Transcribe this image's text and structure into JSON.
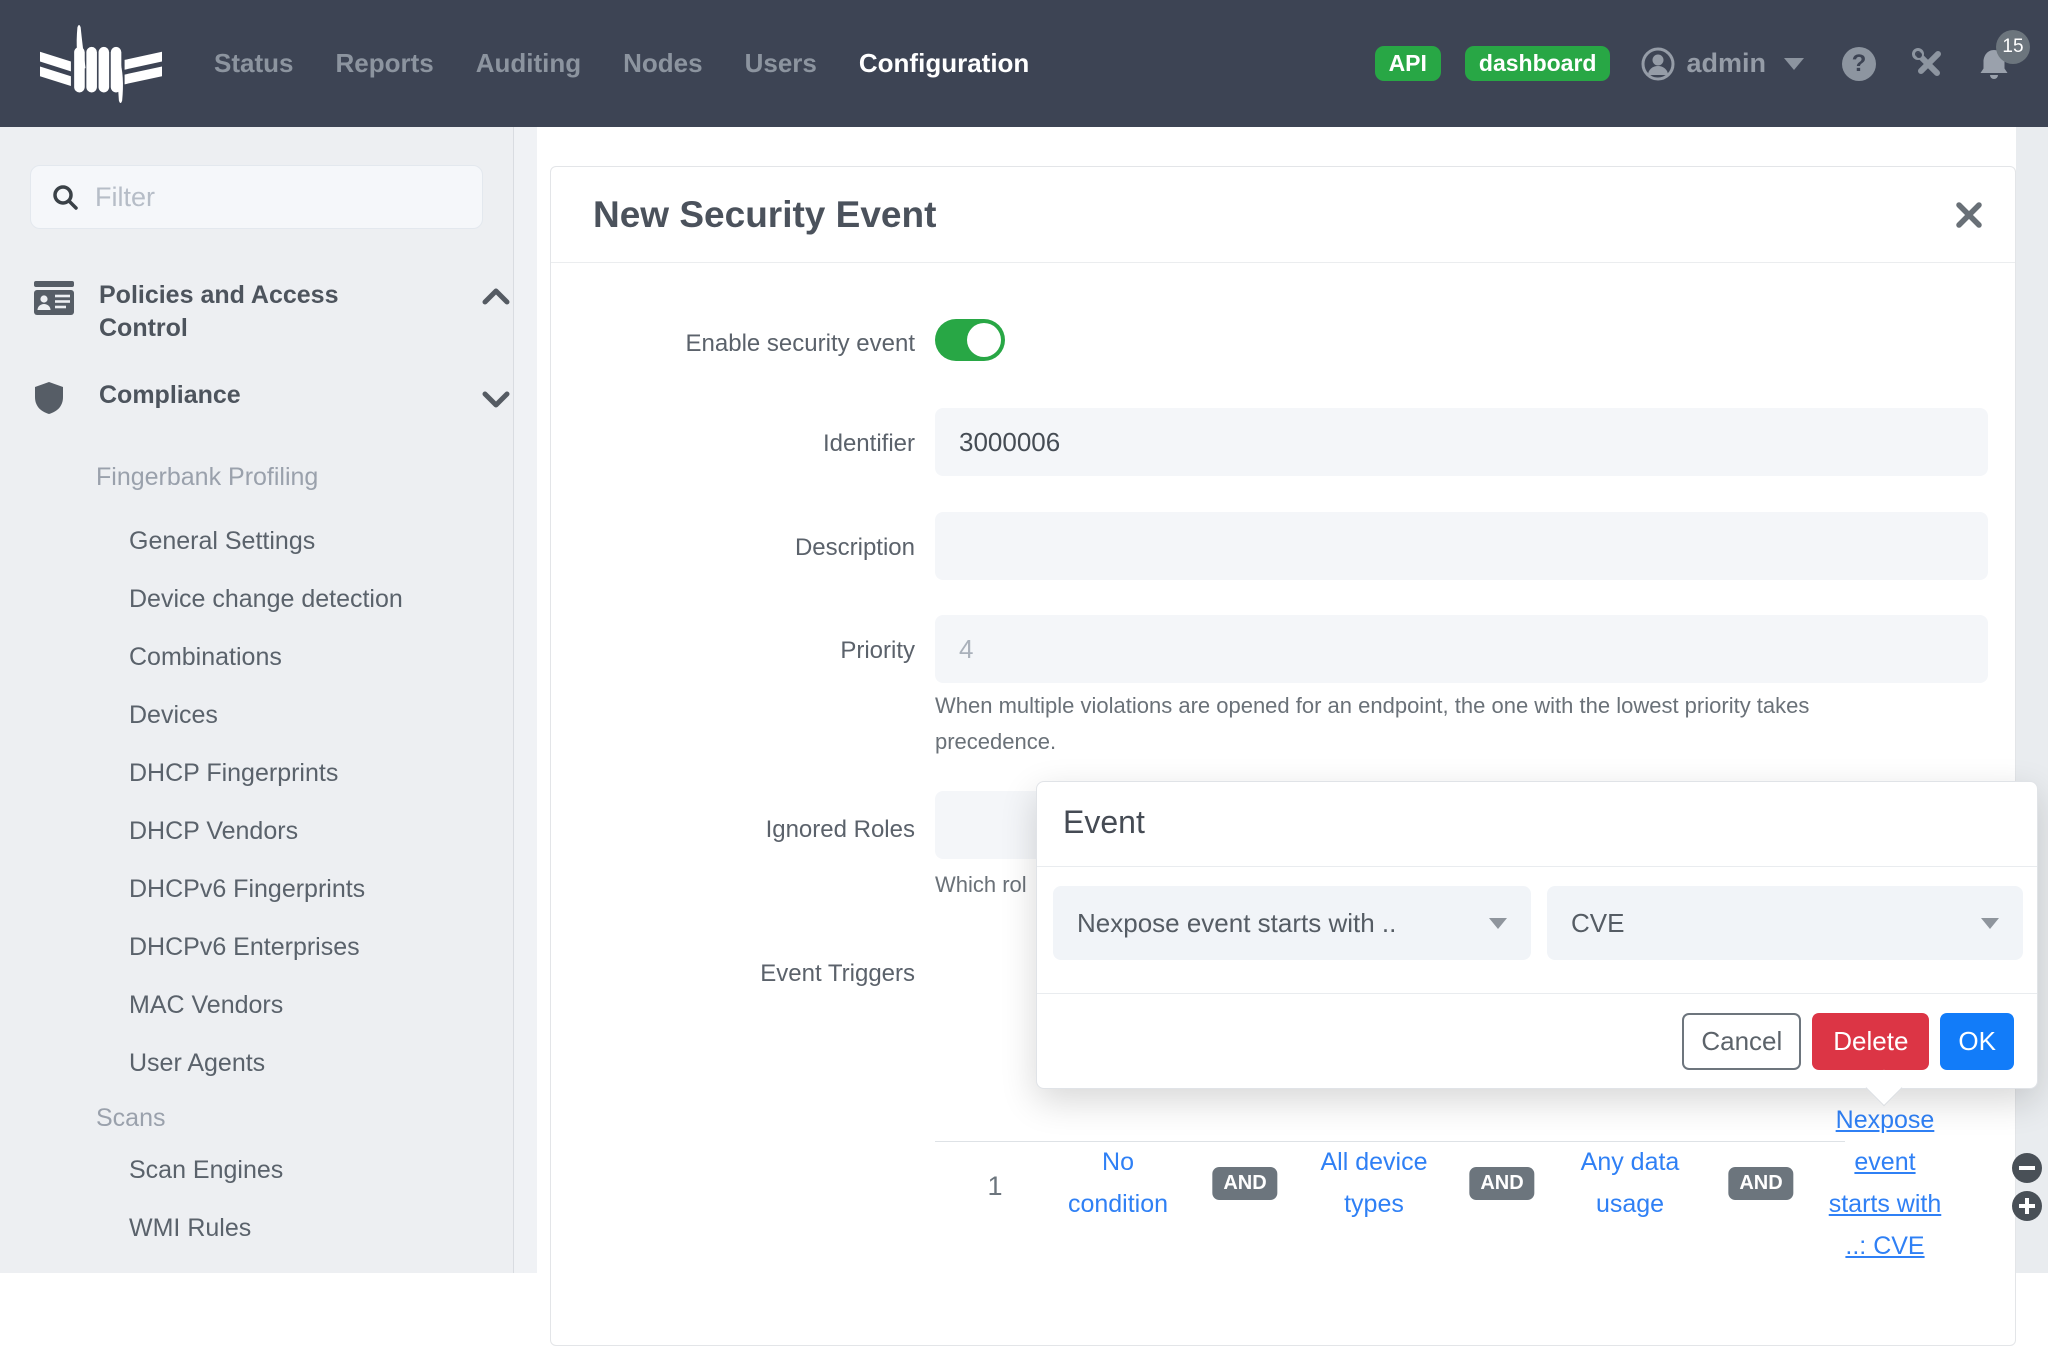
{
  "navbar": {
    "logo_alt": "PacketFence",
    "items": [
      {
        "label": "Status"
      },
      {
        "label": "Reports"
      },
      {
        "label": "Auditing"
      },
      {
        "label": "Nodes"
      },
      {
        "label": "Users"
      },
      {
        "label": "Configuration",
        "active": true
      }
    ],
    "api_badge": "API",
    "dashboard_badge": "dashboard",
    "username": "admin",
    "notification_count": "15"
  },
  "icons": {
    "help_glyph": "?"
  },
  "sidebar": {
    "filter_placeholder": "Filter",
    "sections": [
      {
        "label": "Policies and Access Control",
        "icon": "id-card",
        "state": "expanded"
      },
      {
        "label": "Compliance",
        "icon": "shield",
        "state": "collapsed"
      }
    ],
    "groups": [
      {
        "heading": "Fingerbank Profiling",
        "items": [
          {
            "label": "General Settings"
          },
          {
            "label": "Device change detection"
          },
          {
            "label": "Combinations"
          },
          {
            "label": "Devices"
          },
          {
            "label": "DHCP Fingerprints"
          },
          {
            "label": "DHCP Vendors"
          },
          {
            "label": "DHCPv6 Fingerprints"
          },
          {
            "label": "DHCPv6 Enterprises"
          },
          {
            "label": "MAC Vendors"
          },
          {
            "label": "User Agents"
          }
        ]
      },
      {
        "heading": "Scans",
        "items": [
          {
            "label": "Scan Engines"
          },
          {
            "label": "WMI Rules"
          }
        ]
      }
    ]
  },
  "modal": {
    "title": "New Security Event",
    "enable_label": "Enable security event",
    "enable_state": "on",
    "identifier_label": "Identifier",
    "identifier_value": "3000006",
    "description_label": "Description",
    "description_value": "",
    "priority_label": "Priority",
    "priority_placeholder": "4",
    "priority_help": "When multiple violations are opened for an endpoint, the one with the lowest priority takes\nprecedence.",
    "ignored_roles_label": "Ignored Roles",
    "ignored_roles_help_fragment": "Which rol",
    "event_triggers_label": "Event Triggers"
  },
  "popover": {
    "title": "Event",
    "condition_value": "Nexpose event starts with ..",
    "value_value": "CVE",
    "cancel_label": "Cancel",
    "delete_label": "Delete",
    "ok_label": "OK"
  },
  "trigger_row": {
    "index": "1",
    "condition": "No condition",
    "operator": "AND",
    "device_types": "All device types",
    "data_usage": "Any data usage",
    "event": "Nexpose event starts with ..: CVE"
  },
  "colors": {
    "navbar_bg": "#3d4454",
    "badge_green": "#28a745",
    "toggle_green": "#28a745",
    "delete_red": "#dc3545",
    "ok_blue": "#127cf9",
    "link_blue": "#2f80f5",
    "operator_gray": "#6c757d"
  }
}
